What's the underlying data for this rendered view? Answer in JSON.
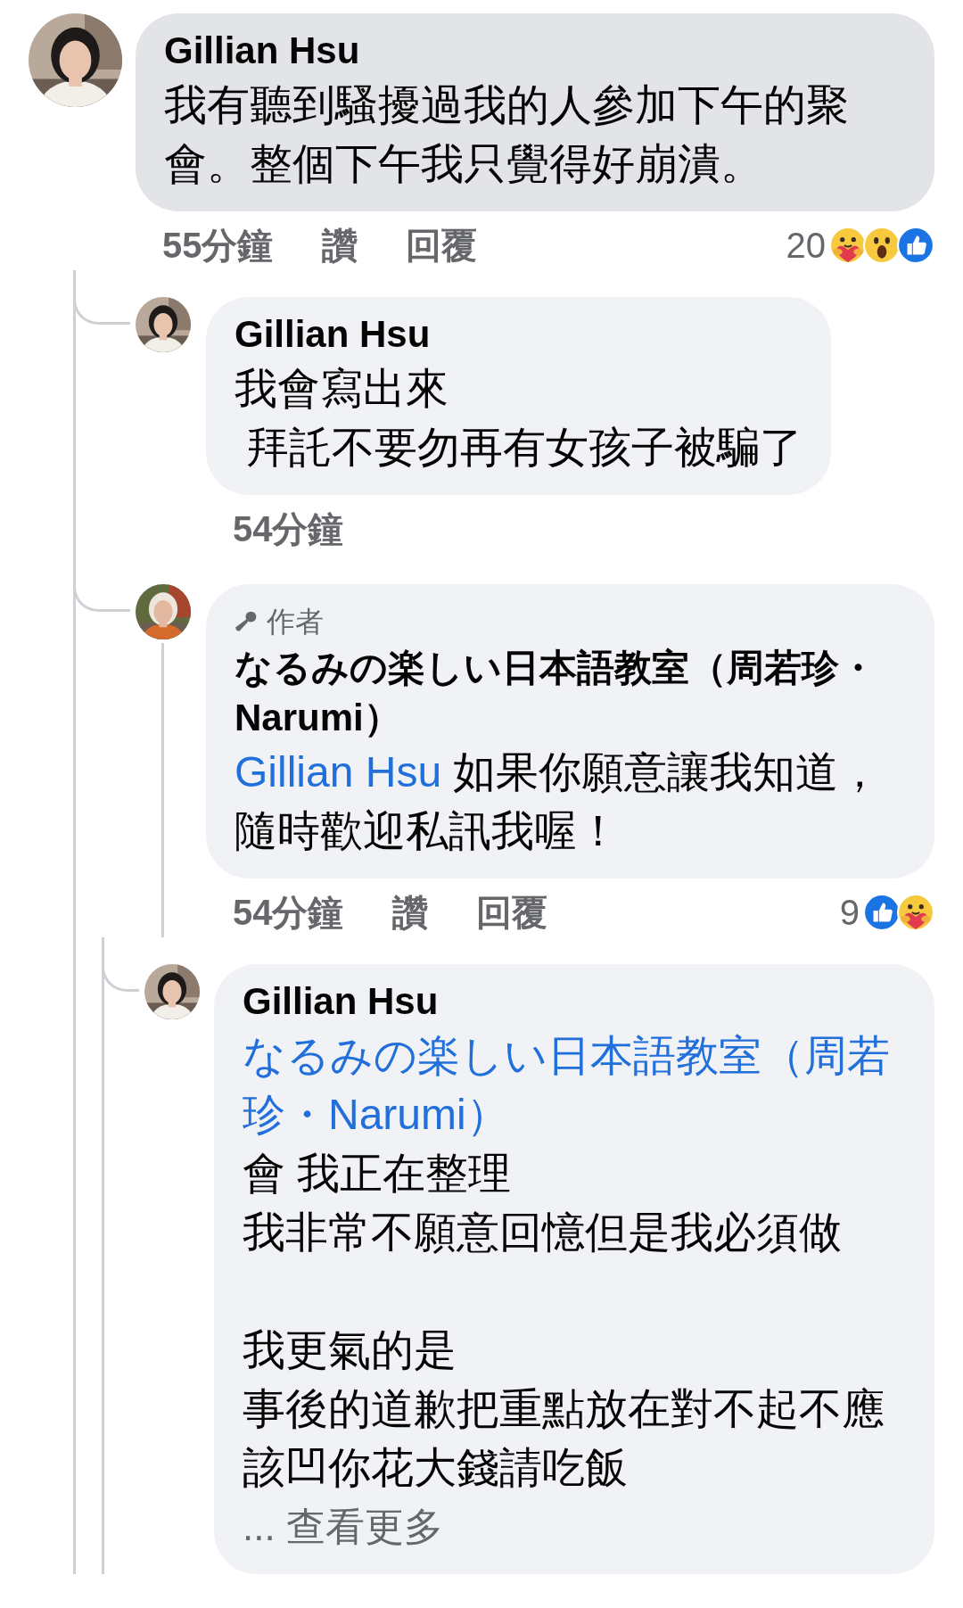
{
  "comments": [
    {
      "author": "Gillian Hsu",
      "highlighted": true,
      "text": "我有聽到騷擾過我的人參加下午的聚會。整個下午我只覺得好崩潰。",
      "time": "55分鐘",
      "actions": [
        "讚",
        "回覆"
      ],
      "reaction_count": "20",
      "reactions": [
        {
          "kind": "care"
        },
        {
          "kind": "wow"
        },
        {
          "kind": "like"
        }
      ],
      "replies": [
        {
          "author": "Gillian Hsu",
          "highlighted": false,
          "paragraphs": [
            [
              "我會寫出來",
              " 拜託不要勿再有女孩子被騙了"
            ]
          ],
          "time": "54分鐘"
        },
        {
          "author_badge": "作者",
          "author": "なるみの楽しい日本語教室（周若珍・Narumi）",
          "highlighted": false,
          "mention": "Gillian Hsu",
          "text": "如果你願意讓我知道，隨時歡迎私訊我喔！",
          "time": "54分鐘",
          "actions": [
            "讚",
            "回覆"
          ],
          "reaction_count": "9",
          "reactions": [
            {
              "kind": "like"
            },
            {
              "kind": "care"
            }
          ],
          "replies": [
            {
              "author": "Gillian Hsu",
              "highlighted": false,
              "mention": "なるみの楽しい日本語教室（周若珍・Narumi）",
              "paragraphs": [
                [
                  "會 我正在整理",
                  "我非常不願意回憶但是我必須做"
                ],
                [
                  "我更氣的是",
                  "事後的道歉把重點放在對不起不應該凹你花大錢請吃飯"
                ]
              ],
              "see_more": "... 查看更多"
            }
          ]
        }
      ]
    }
  ]
}
